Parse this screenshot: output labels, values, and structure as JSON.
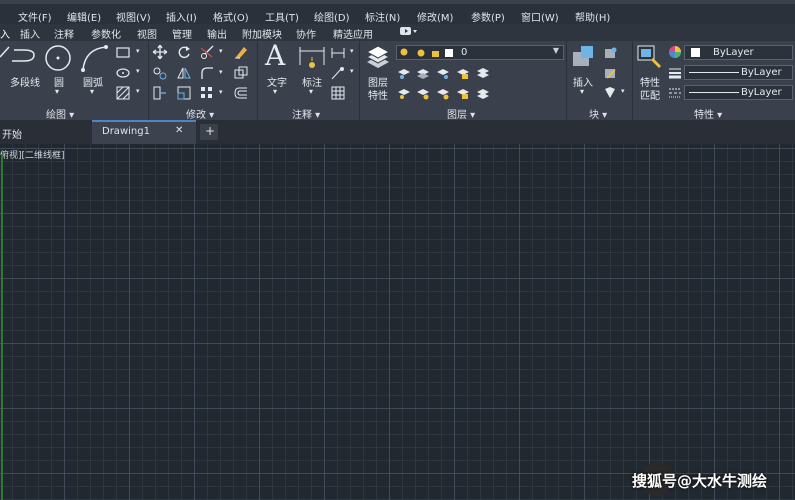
{
  "menubar": {
    "items": [
      "文件(F)",
      "编辑(E)",
      "视图(V)",
      "插入(I)",
      "格式(O)",
      "工具(T)",
      "绘图(D)",
      "标注(N)",
      "修改(M)",
      "参数(P)",
      "窗口(W)",
      "帮助(H)"
    ]
  },
  "ribbon_tabs": {
    "items": [
      "入",
      "插入",
      "注释",
      "参数化",
      "视图",
      "管理",
      "输出",
      "附加模块",
      "协作",
      "精选应用"
    ]
  },
  "ribbon": {
    "draw_panel": {
      "title": "绘图 ▾",
      "polyline_label": "多段线",
      "circle_label": "圆",
      "arc_label": "圆弧"
    },
    "modify_panel": {
      "title": "修改 ▾"
    },
    "annotation_panel": {
      "title": "注释 ▾",
      "text_label": "文字",
      "dimension_label": "标注"
    },
    "layers_panel": {
      "title": "图层 ▾",
      "layer_props_label_1": "图层",
      "layer_props_label_2": "特性",
      "current_layer": "0"
    },
    "block_panel": {
      "title": "块 ▾",
      "insert_label": "插入"
    },
    "properties_panel": {
      "title": "特性 ▾",
      "match_label_1": "特性",
      "match_label_2": "匹配",
      "color_value": "ByLayer",
      "linetype_value": "ByLayer",
      "lineweight_value": "ByLayer"
    }
  },
  "file_tabs": {
    "start_label": "开始",
    "drawing_label": "Drawing1",
    "close_glyph": "✕",
    "new_tab_glyph": "+"
  },
  "canvas": {
    "viewport_label": "俯视][二维线框]"
  },
  "watermark": {
    "text": "搜狐号@大水牛测绘"
  },
  "colors": {
    "canvas_bg": "#212830",
    "ribbon_bg": "#3a414c",
    "menubar_bg": "#2b313a",
    "y_axis": "#2f7a32"
  }
}
